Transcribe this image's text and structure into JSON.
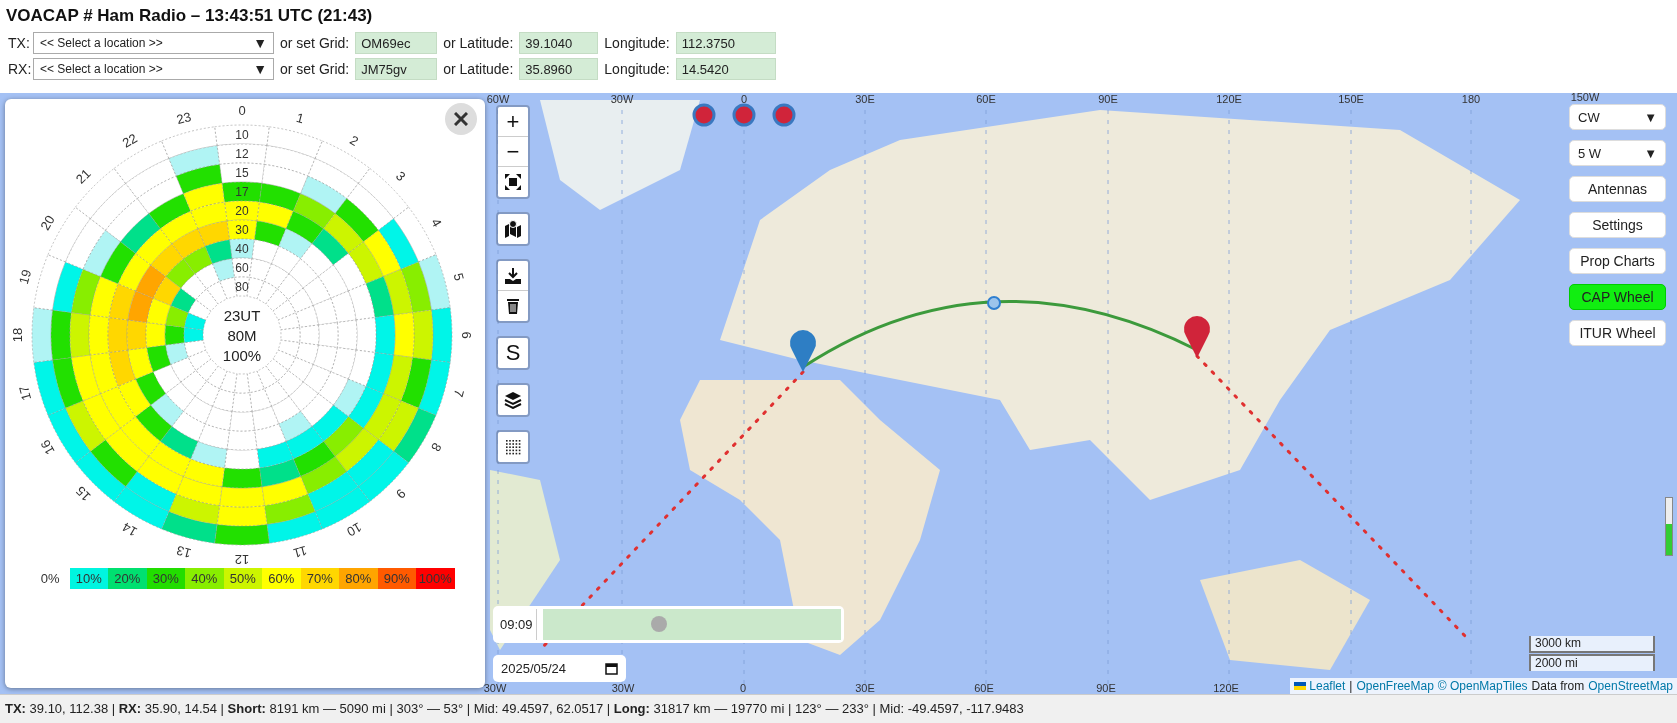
{
  "title": "VOACAP # Ham Radio – 13:43:51 UTC (21:43)",
  "locations": [
    {
      "label": "TX:",
      "select": {
        "placeholder": "<< Select a location >>",
        "arrow": "▼"
      },
      "grid_label": "or set Grid:",
      "grid": "OM69ec",
      "lat_label": "or Latitude:",
      "latitude": "39.1040",
      "lon_label": "Longitude:",
      "longitude": "112.3750"
    },
    {
      "label": "RX:",
      "select": {
        "placeholder": "<< Select a location >>",
        "arrow": "▼"
      },
      "grid_label": "or set Grid:",
      "grid": "JM75gv",
      "lat_label": "or Latitude:",
      "latitude": "35.8960",
      "lon_label": "Longitude:",
      "longitude": "14.5420"
    }
  ],
  "wheel": {
    "hour_labels": [
      "0",
      "1",
      "2",
      "3",
      "4",
      "5",
      "6",
      "7",
      "8",
      "9",
      "10",
      "11",
      "12",
      "13",
      "14",
      "15",
      "16",
      "17",
      "18",
      "19",
      "20",
      "21",
      "22",
      "23"
    ],
    "rings": [
      {
        "label": "10",
        "cells": [
          {
            "color": "#ffffff"
          },
          {
            "color": "#ffffff"
          },
          {
            "color": "#ffffff"
          },
          {
            "color": "#ffffff"
          },
          {
            "color": "#ffffff"
          },
          {
            "color": "#b0f4f4"
          },
          {
            "color": "#00f5e8"
          },
          {
            "color": "#00f5e8"
          },
          {
            "color": "#00e08a"
          },
          {
            "color": "#00f5e8"
          },
          {
            "color": "#00f5e8"
          },
          {
            "color": "#00f5e8"
          },
          {
            "color": "#22e000"
          },
          {
            "color": "#00e08a"
          },
          {
            "color": "#00f5e8"
          },
          {
            "color": "#00f5e8"
          },
          {
            "color": "#00f5e8"
          },
          {
            "color": "#00f5e8"
          },
          {
            "color": "#b0f4f4"
          },
          {
            "color": "#ffffff"
          },
          {
            "color": "#ffffff"
          },
          {
            "color": "#ffffff"
          },
          {
            "color": "#ffffff"
          },
          {
            "color": "#ffffff"
          }
        ]
      },
      {
        "label": "12",
        "cells": [
          {
            "color": "#ffffff"
          },
          {
            "color": "#ffffff"
          },
          {
            "color": "#ffffff"
          },
          {
            "color": "#ffffff"
          },
          {
            "color": "#00f5e8"
          },
          {
            "color": "#88ee00"
          },
          {
            "color": "#ccf500"
          },
          {
            "color": "#22e000"
          },
          {
            "color": "#ccf500"
          },
          {
            "color": "#00f5e8"
          },
          {
            "color": "#00f5e8"
          },
          {
            "color": "#88ee00"
          },
          {
            "color": "#ffff00"
          },
          {
            "color": "#ccf500"
          },
          {
            "color": "#00f5e8"
          },
          {
            "color": "#22e000"
          },
          {
            "color": "#ccf500"
          },
          {
            "color": "#22e000"
          },
          {
            "color": "#22e000"
          },
          {
            "color": "#00f5e8"
          },
          {
            "color": "#ffffff"
          },
          {
            "color": "#ffffff"
          },
          {
            "color": "#ffffff"
          },
          {
            "color": "#b0f4f4"
          }
        ]
      },
      {
        "label": "15",
        "cells": [
          {
            "color": "#ffffff"
          },
          {
            "color": "#ffffff"
          },
          {
            "color": "#b0f4f4"
          },
          {
            "color": "#22e000"
          },
          {
            "color": "#ffff00"
          },
          {
            "color": "#ccf500"
          },
          {
            "color": "#ffff00"
          },
          {
            "color": "#ccf500"
          },
          {
            "color": "#ccf500"
          },
          {
            "color": "#ccf500"
          },
          {
            "color": "#88ee00"
          },
          {
            "color": "#ffff00"
          },
          {
            "color": "#ffff00"
          },
          {
            "color": "#ffff00"
          },
          {
            "color": "#ffff00"
          },
          {
            "color": "#ffff00"
          },
          {
            "color": "#ffff00"
          },
          {
            "color": "#ffff00"
          },
          {
            "color": "#ccf500"
          },
          {
            "color": "#88ee00"
          },
          {
            "color": "#b0f4f4"
          },
          {
            "color": "#ffffff"
          },
          {
            "color": "#ffffff"
          },
          {
            "color": "#22e000"
          }
        ]
      },
      {
        "label": "17",
        "cells": [
          {
            "color": "#22e000"
          },
          {
            "color": "#22e000"
          },
          {
            "color": "#88ee00"
          },
          {
            "color": "#ccf500"
          },
          {
            "color": "#ccf500"
          },
          {
            "color": "#00e08a"
          },
          {
            "color": "#00f5e8"
          },
          {
            "color": "#00f5e8"
          },
          {
            "color": "#00f5e8"
          },
          {
            "color": "#88ee00"
          },
          {
            "color": "#22e000"
          },
          {
            "color": "#00e08a"
          },
          {
            "color": "#22e000"
          },
          {
            "color": "#ffff00"
          },
          {
            "color": "#ffff00"
          },
          {
            "color": "#ffff00"
          },
          {
            "color": "#ffff00"
          },
          {
            "color": "#ffff00"
          },
          {
            "color": "#ffff00"
          },
          {
            "color": "#ffff00"
          },
          {
            "color": "#22e000"
          },
          {
            "color": "#00e08a"
          },
          {
            "color": "#22e000"
          },
          {
            "color": "#ffff00"
          }
        ]
      },
      {
        "label": "20",
        "cells": [
          {
            "color": "#ffff00"
          },
          {
            "color": "#ffff00"
          },
          {
            "color": "#22e000"
          },
          {
            "color": "#00e08a"
          },
          {
            "color": "#ffffff"
          },
          {
            "color": "#ffffff"
          },
          {
            "color": "#ffffff"
          },
          {
            "color": "#ffffff"
          },
          {
            "color": "#b0f4f4"
          },
          {
            "color": "#00f5e8"
          },
          {
            "color": "#00f5e8"
          },
          {
            "color": "#00f5e8"
          },
          {
            "color": "#ffffff"
          },
          {
            "color": "#b0f4f4"
          },
          {
            "color": "#00e08a"
          },
          {
            "color": "#22e000"
          },
          {
            "color": "#ffff00"
          },
          {
            "color": "#ffd700"
          },
          {
            "color": "#ffd700"
          },
          {
            "color": "#ffd700"
          },
          {
            "color": "#ffff00"
          },
          {
            "color": "#ffff00"
          },
          {
            "color": "#ffff00"
          },
          {
            "color": "#ffff00"
          }
        ]
      },
      {
        "label": "30",
        "cells": [
          {
            "color": "#ffff00"
          },
          {
            "color": "#22e000"
          },
          {
            "color": "#b0f4f4"
          },
          {
            "color": "#ffffff"
          },
          {
            "color": "#ffffff"
          },
          {
            "color": "#ffffff"
          },
          {
            "color": "#ffffff"
          },
          {
            "color": "#ffffff"
          },
          {
            "color": "#ffffff"
          },
          {
            "color": "#ffffff"
          },
          {
            "color": "#b0f4f4"
          },
          {
            "color": "#ffffff"
          },
          {
            "color": "#ffffff"
          },
          {
            "color": "#ffffff"
          },
          {
            "color": "#ffffff"
          },
          {
            "color": "#b0f4f4"
          },
          {
            "color": "#22e000"
          },
          {
            "color": "#ffff00"
          },
          {
            "color": "#ffd700"
          },
          {
            "color": "#ffa500"
          },
          {
            "color": "#ffa500"
          },
          {
            "color": "#ffd700"
          },
          {
            "color": "#ffd700"
          },
          {
            "color": "#ffd700"
          }
        ]
      },
      {
        "label": "40",
        "cells": [
          {
            "color": "#b0f4f4"
          },
          {
            "color": "#ffffff"
          },
          {
            "color": "#ffffff"
          },
          {
            "color": "#ffffff"
          },
          {
            "color": "#ffffff"
          },
          {
            "color": "#ffffff"
          },
          {
            "color": "#ffffff"
          },
          {
            "color": "#ffffff"
          },
          {
            "color": "#ffffff"
          },
          {
            "color": "#ffffff"
          },
          {
            "color": "#ffffff"
          },
          {
            "color": "#ffffff"
          },
          {
            "color": "#ffffff"
          },
          {
            "color": "#ffffff"
          },
          {
            "color": "#ffffff"
          },
          {
            "color": "#ffffff"
          },
          {
            "color": "#ffffff"
          },
          {
            "color": "#22e000"
          },
          {
            "color": "#ffff00"
          },
          {
            "color": "#ffff00"
          },
          {
            "color": "#ffd700"
          },
          {
            "color": "#88ee00"
          },
          {
            "color": "#88ee00"
          },
          {
            "color": "#00e08a"
          }
        ]
      },
      {
        "label": "60",
        "cells": [
          {
            "color": "#ffffff"
          },
          {
            "color": "#ffffff"
          },
          {
            "color": "#ffffff"
          },
          {
            "color": "#ffffff"
          },
          {
            "color": "#ffffff"
          },
          {
            "color": "#ffffff"
          },
          {
            "color": "#ffffff"
          },
          {
            "color": "#ffffff"
          },
          {
            "color": "#ffffff"
          },
          {
            "color": "#ffffff"
          },
          {
            "color": "#ffffff"
          },
          {
            "color": "#ffffff"
          },
          {
            "color": "#ffffff"
          },
          {
            "color": "#ffffff"
          },
          {
            "color": "#ffffff"
          },
          {
            "color": "#ffffff"
          },
          {
            "color": "#ffffff"
          },
          {
            "color": "#b0f4f4"
          },
          {
            "color": "#22e000"
          },
          {
            "color": "#88ee00"
          },
          {
            "color": "#00e08a"
          },
          {
            "color": "#ffffff"
          },
          {
            "color": "#ffffff"
          },
          {
            "color": "#b0f4f4"
          }
        ]
      },
      {
        "label": "80",
        "cells": [
          {
            "color": "#ffffff"
          },
          {
            "color": "#ffffff"
          },
          {
            "color": "#ffffff"
          },
          {
            "color": "#ffffff"
          },
          {
            "color": "#ffffff"
          },
          {
            "color": "#ffffff"
          },
          {
            "color": "#ffffff"
          },
          {
            "color": "#ffffff"
          },
          {
            "color": "#ffffff"
          },
          {
            "color": "#ffffff"
          },
          {
            "color": "#ffffff"
          },
          {
            "color": "#ffffff"
          },
          {
            "color": "#ffffff"
          },
          {
            "color": "#ffffff"
          },
          {
            "color": "#ffffff"
          },
          {
            "color": "#ffffff"
          },
          {
            "color": "#ffffff"
          },
          {
            "color": "#ffffff"
          },
          {
            "color": "#00f5e8"
          },
          {
            "color": "#00f5e8"
          },
          {
            "color": "#ffffff"
          },
          {
            "color": "#ffffff"
          },
          {
            "color": "#ffffff"
          },
          {
            "color": "#ffffff"
          }
        ]
      }
    ],
    "center_lines": [
      "23UT",
      "80M",
      "100%"
    ],
    "legend": [
      {
        "label": "0%",
        "color": "#ffffff"
      },
      {
        "label": "10%",
        "color": "#00f5e0"
      },
      {
        "label": "20%",
        "color": "#00e070"
      },
      {
        "label": "30%",
        "color": "#22dd00"
      },
      {
        "label": "40%",
        "color": "#88ee00"
      },
      {
        "label": "50%",
        "color": "#ccf500"
      },
      {
        "label": "60%",
        "color": "#ffff00"
      },
      {
        "label": "70%",
        "color": "#ffd700"
      },
      {
        "label": "80%",
        "color": "#ffa500"
      },
      {
        "label": "90%",
        "color": "#ff5a00"
      },
      {
        "label": "100%",
        "color": "#ff0000"
      }
    ]
  },
  "map": {
    "top_labels": [
      "60W",
      "30W",
      "0",
      "30E",
      "60E",
      "90E",
      "120E",
      "150E",
      "180",
      "150W"
    ],
    "bottom_labels": [
      "30W",
      "30W",
      "0",
      "30E",
      "60E",
      "90E",
      "120E"
    ],
    "controls": [
      [
        {
          "kind": "zoom_in",
          "label": "+"
        },
        {
          "kind": "zoom_out",
          "label": "−"
        },
        {
          "kind": "fullscreen"
        }
      ],
      [
        {
          "kind": "map"
        }
      ],
      [
        {
          "kind": "download"
        },
        {
          "kind": "delete"
        }
      ],
      [
        {
          "kind": "letter",
          "label": "S"
        }
      ],
      [
        {
          "kind": "layers"
        }
      ],
      [
        {
          "kind": "grid"
        }
      ]
    ],
    "time_slider": {
      "time": "09:09",
      "level": 0.39
    },
    "date": "2025/05/24",
    "scale": [
      "3000 km",
      "2000 mi"
    ],
    "attribution": [
      {
        "kind": "link",
        "text": "Leaflet",
        "flag": true
      },
      {
        "kind": "text",
        "text": "|"
      },
      {
        "kind": "link",
        "text": "OpenFreeMap"
      },
      {
        "kind": "link",
        "text": "© OpenMapTiles"
      },
      {
        "kind": "text",
        "text": "Data from"
      },
      {
        "kind": "link",
        "text": "OpenStreetMap"
      }
    ],
    "side_slider": {
      "level": 0.55
    },
    "side_buttons": [
      {
        "kind": "select",
        "label": "CW",
        "arrow": "▼",
        "selected": false
      },
      {
        "kind": "select",
        "label": "5 W",
        "arrow": "▼",
        "selected": false
      },
      {
        "kind": "button",
        "label": "Antennas",
        "selected": false
      },
      {
        "kind": "button",
        "label": "Settings",
        "selected": false
      },
      {
        "kind": "button",
        "label": "Prop Charts",
        "selected": false
      },
      {
        "kind": "button",
        "label": "CAP Wheel",
        "selected": true
      },
      {
        "kind": "button",
        "label": "ITUR Wheel",
        "selected": false
      }
    ]
  },
  "status": "**TX:** 39.10, 112.38 | **RX:** 35.90, 14.54 | **Short:** 8191 km — 5090 mi |  303° — 53° | Mid: 49.4597, 62.0517 | **Long:** 31817 km — 19770 mi |  123° — 233° | Mid: -49.4597, -117.9483"
}
